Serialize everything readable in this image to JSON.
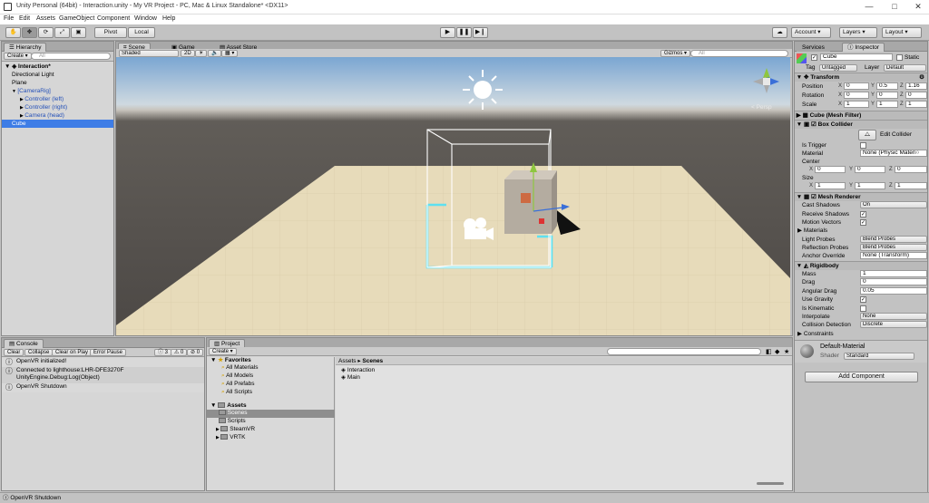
{
  "window": {
    "title": "Unity Personal (64bit) - Interaction.unity - My VR Project - PC, Mac & Linux Standalone* <DX11>",
    "controls": [
      "—",
      "□",
      "✕"
    ]
  },
  "menu": [
    "File",
    "Edit",
    "Assets",
    "GameObject",
    "Component",
    "Window",
    "Help"
  ],
  "toolbar": {
    "pivot": "Pivot",
    "local": "Local",
    "account": "Account",
    "layers": "Layers",
    "layout": "Layout"
  },
  "hierarchy": {
    "tab": "Hierarchy",
    "create": "Create",
    "search_placeholder": "All",
    "scene": "Interaction*",
    "items": [
      {
        "label": "Directional Light",
        "indent": 1,
        "selected": false,
        "blue": false,
        "arrow": ""
      },
      {
        "label": "Plane",
        "indent": 1,
        "selected": false,
        "blue": false,
        "arrow": ""
      },
      {
        "label": "[CameraRig]",
        "indent": 1,
        "selected": false,
        "blue": true,
        "arrow": "▼"
      },
      {
        "label": "Controller (left)",
        "indent": 2,
        "selected": false,
        "blue": true,
        "arrow": "▶"
      },
      {
        "label": "Controller (right)",
        "indent": 2,
        "selected": false,
        "blue": true,
        "arrow": "▶"
      },
      {
        "label": "Camera (head)",
        "indent": 2,
        "selected": false,
        "blue": true,
        "arrow": "▶"
      },
      {
        "label": "Cube",
        "indent": 1,
        "selected": true,
        "blue": false,
        "arrow": ""
      }
    ]
  },
  "scene_tabs": [
    "Scene",
    "Game",
    "Asset Store"
  ],
  "scene_bar": {
    "shading": "Shaded",
    "mode2d": "2D",
    "gizmos": "Gizmos",
    "search_placeholder": "All",
    "persp": "< Persp"
  },
  "inspector": {
    "tabs": [
      "Services",
      "Inspector"
    ],
    "object_name": "Cube",
    "static_label": "Static",
    "tag_label": "Tag",
    "tag_value": "Untagged",
    "layer_label": "Layer",
    "layer_value": "Default",
    "transform": {
      "title": "Transform",
      "position_label": "Position",
      "position": [
        "0",
        "0.5",
        "1.16"
      ],
      "rotation_label": "Rotation",
      "rotation": [
        "0",
        "0",
        "0"
      ],
      "scale_label": "Scale",
      "scale": [
        "1",
        "1",
        "1"
      ]
    },
    "mesh_filter": "Cube (Mesh Filter)",
    "box_collider": {
      "title": "Box Collider",
      "edit_label": "Edit Collider",
      "is_trigger": "Is Trigger",
      "material": "Material",
      "material_value": "None (Physic Materi○",
      "center": "Center",
      "center_values": [
        "0",
        "0",
        "0"
      ],
      "size": "Size",
      "size_values": [
        "1",
        "1",
        "1"
      ]
    },
    "mesh_renderer": {
      "title": "Mesh Renderer",
      "cast_shadows": "Cast Shadows",
      "cast_shadows_value": "On",
      "receive_shadows": "Receive Shadows",
      "motion_vectors": "Motion Vectors",
      "materials": "Materials",
      "light_probes": "Light Probes",
      "light_probes_value": "Blend Probes",
      "reflection_probes": "Reflection Probes",
      "reflection_probes_value": "Blend Probes",
      "anchor_override": "Anchor Override",
      "anchor_override_value": "None (Transform)"
    },
    "rigidbody": {
      "title": "Rigidbody",
      "mass": "Mass",
      "mass_value": "1",
      "drag": "Drag",
      "drag_value": "0",
      "angular_drag": "Angular Drag",
      "angular_drag_value": "0.05",
      "use_gravity": "Use Gravity",
      "is_kinematic": "Is Kinematic",
      "interpolate": "Interpolate",
      "interpolate_value": "None",
      "collision_detection": "Collision Detection",
      "collision_detection_value": "Discrete",
      "constraints": "Constraints"
    },
    "material": {
      "name": "Default-Material",
      "shader_label": "Shader",
      "shader_value": "Standard"
    },
    "add_component": "Add Component"
  },
  "console": {
    "tab": "Console",
    "buttons": [
      "Clear",
      "Collapse",
      "Clear on Play",
      "Error Pause"
    ],
    "counts": [
      "3",
      "0",
      "0"
    ],
    "messages": [
      [
        "OpenVR initialized!"
      ],
      [
        "Connected to lighthouse:LHR-DFE3270F",
        "UnityEngine.Debug:Log(Object)"
      ],
      [
        "OpenVR Shutdown"
      ]
    ]
  },
  "project": {
    "tab": "Project",
    "create": "Create",
    "favorites": "Favorites",
    "favorite_items": [
      "All Materials",
      "All Models",
      "All Prefabs",
      "All Scripts"
    ],
    "assets": "Assets",
    "asset_folders": [
      {
        "label": "Scenes",
        "selected": true,
        "arrow": ""
      },
      {
        "label": "Scripts",
        "selected": false,
        "arrow": ""
      },
      {
        "label": "SteamVR",
        "selected": false,
        "arrow": "▶"
      },
      {
        "label": "VRTK",
        "selected": false,
        "arrow": "▶"
      }
    ],
    "breadcrumb_root": "Assets",
    "breadcrumb_sep": "▸",
    "breadcrumb_current": "Scenes",
    "files": [
      "Interaction",
      "Main"
    ]
  },
  "statusbar": "OpenVR Shutdown",
  "colors": {
    "selection": "#3e7de6",
    "sky_top": "#8fb4d8",
    "ground": "#e7dbba",
    "collider": "#ffffff",
    "outline": "#5ee0f0"
  }
}
